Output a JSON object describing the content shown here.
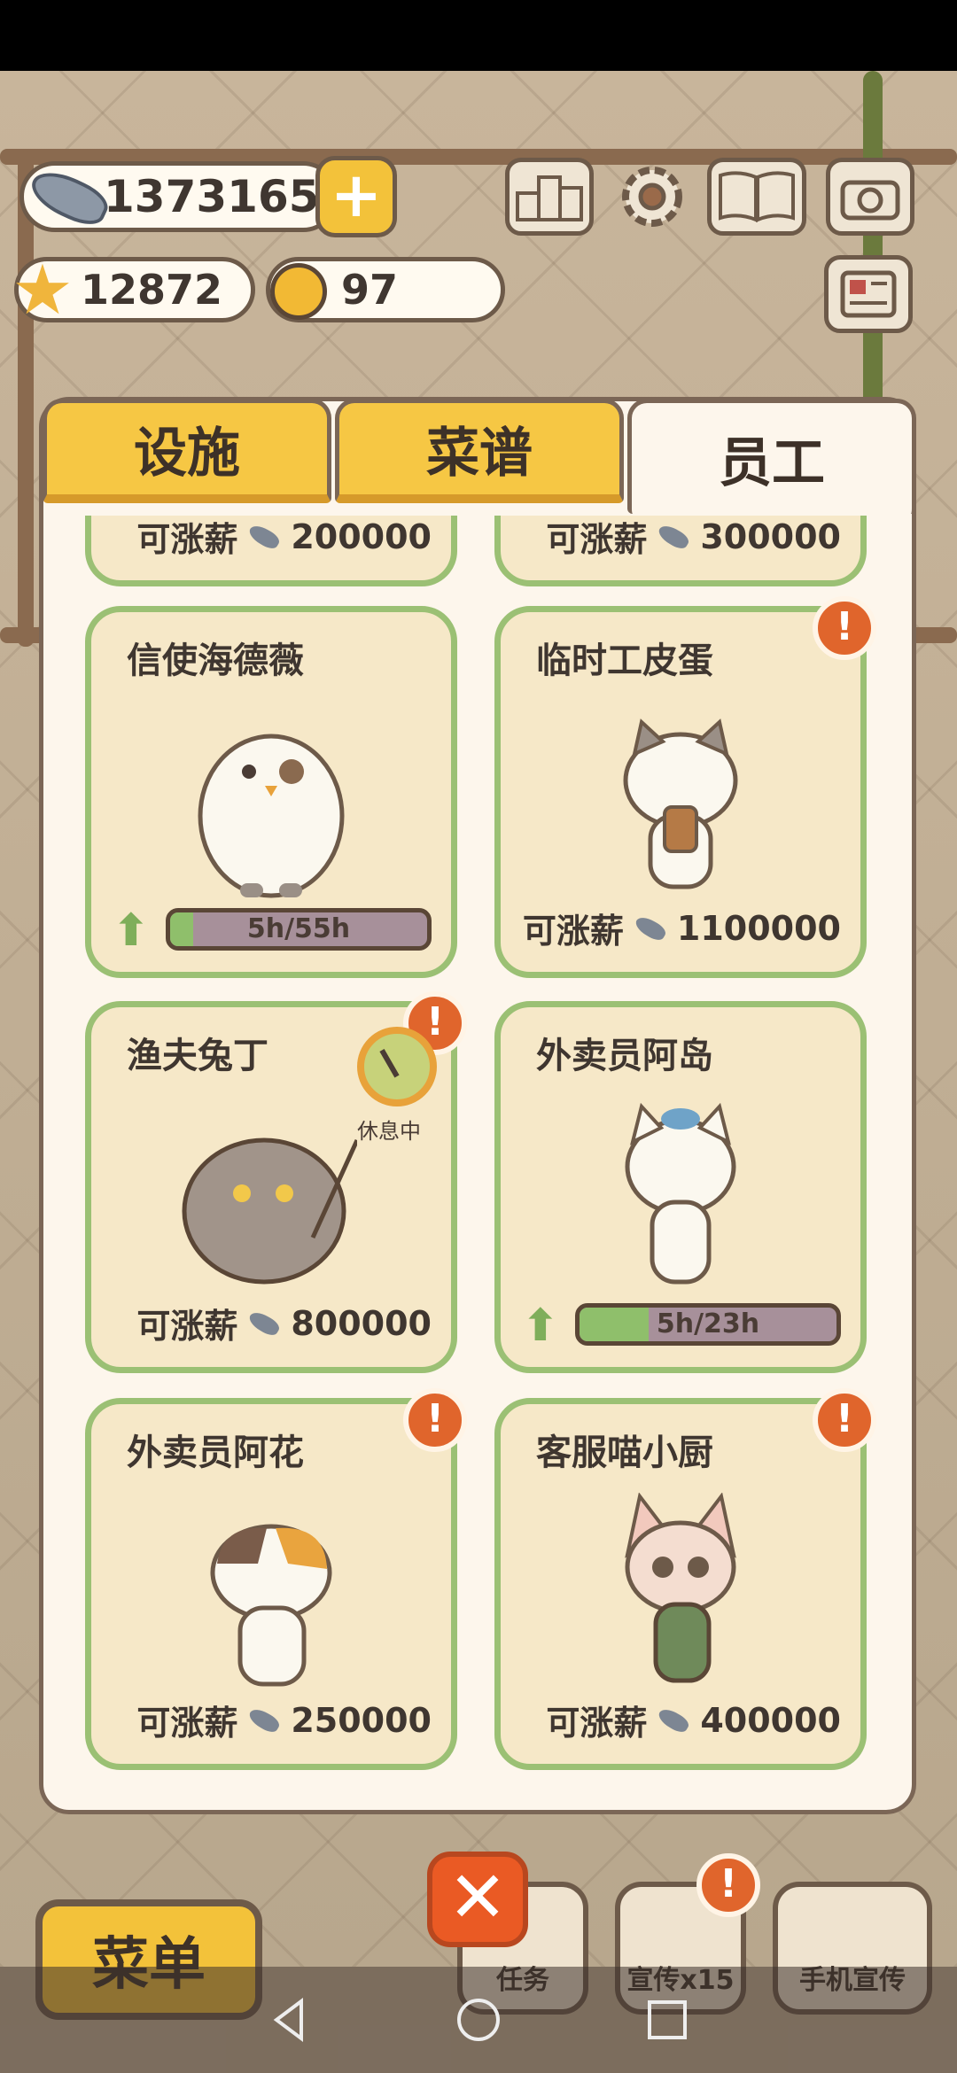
{
  "currency": {
    "fish": "1373165",
    "stars": "12872",
    "bells": "97"
  },
  "top_icons": [
    "ranking-icon",
    "gear-icon",
    "book-icon",
    "camera-icon",
    "newspaper-icon"
  ],
  "tabs": [
    {
      "label": "设施",
      "active": false
    },
    {
      "label": "菜谱",
      "active": false
    },
    {
      "label": "员工",
      "active": true
    }
  ],
  "staff": {
    "partial_top": [
      {
        "raise_label": "可涨薪",
        "raise_amount": "200000"
      },
      {
        "raise_label": "可涨薪",
        "raise_amount": "300000"
      }
    ],
    "cards": [
      {
        "name": "信使海德薇",
        "progress_text": "5h/55h",
        "progress_value": 0.09,
        "alert": false
      },
      {
        "name": "临时工皮蛋",
        "raise_label": "可涨薪",
        "raise_amount": "1100000",
        "alert": true
      },
      {
        "name": "渔夫兔丁",
        "raise_label": "可涨薪",
        "raise_amount": "800000",
        "alert": true,
        "status": "休息中"
      },
      {
        "name": "外卖员阿岛",
        "progress_text": "5h/23h",
        "progress_value": 0.27,
        "alert": false
      },
      {
        "name": "外卖员阿花",
        "raise_label": "可涨薪",
        "raise_amount": "250000",
        "alert": true
      },
      {
        "name": "客服喵小厨",
        "raise_label": "可涨薪",
        "raise_amount": "400000",
        "alert": true
      }
    ]
  },
  "alert_glyph": "!",
  "bottom": {
    "menu": "菜单",
    "tasks": "任务",
    "promote": "宣传x15",
    "phone_promote": "手机宣传",
    "close": "✕"
  },
  "colors": {
    "tab_yellow": "#f6c744",
    "card_border": "#9bc074",
    "card_fill": "#f6e8c8",
    "alert": "#e0652c",
    "progress_fill": "#8fbf6b"
  }
}
